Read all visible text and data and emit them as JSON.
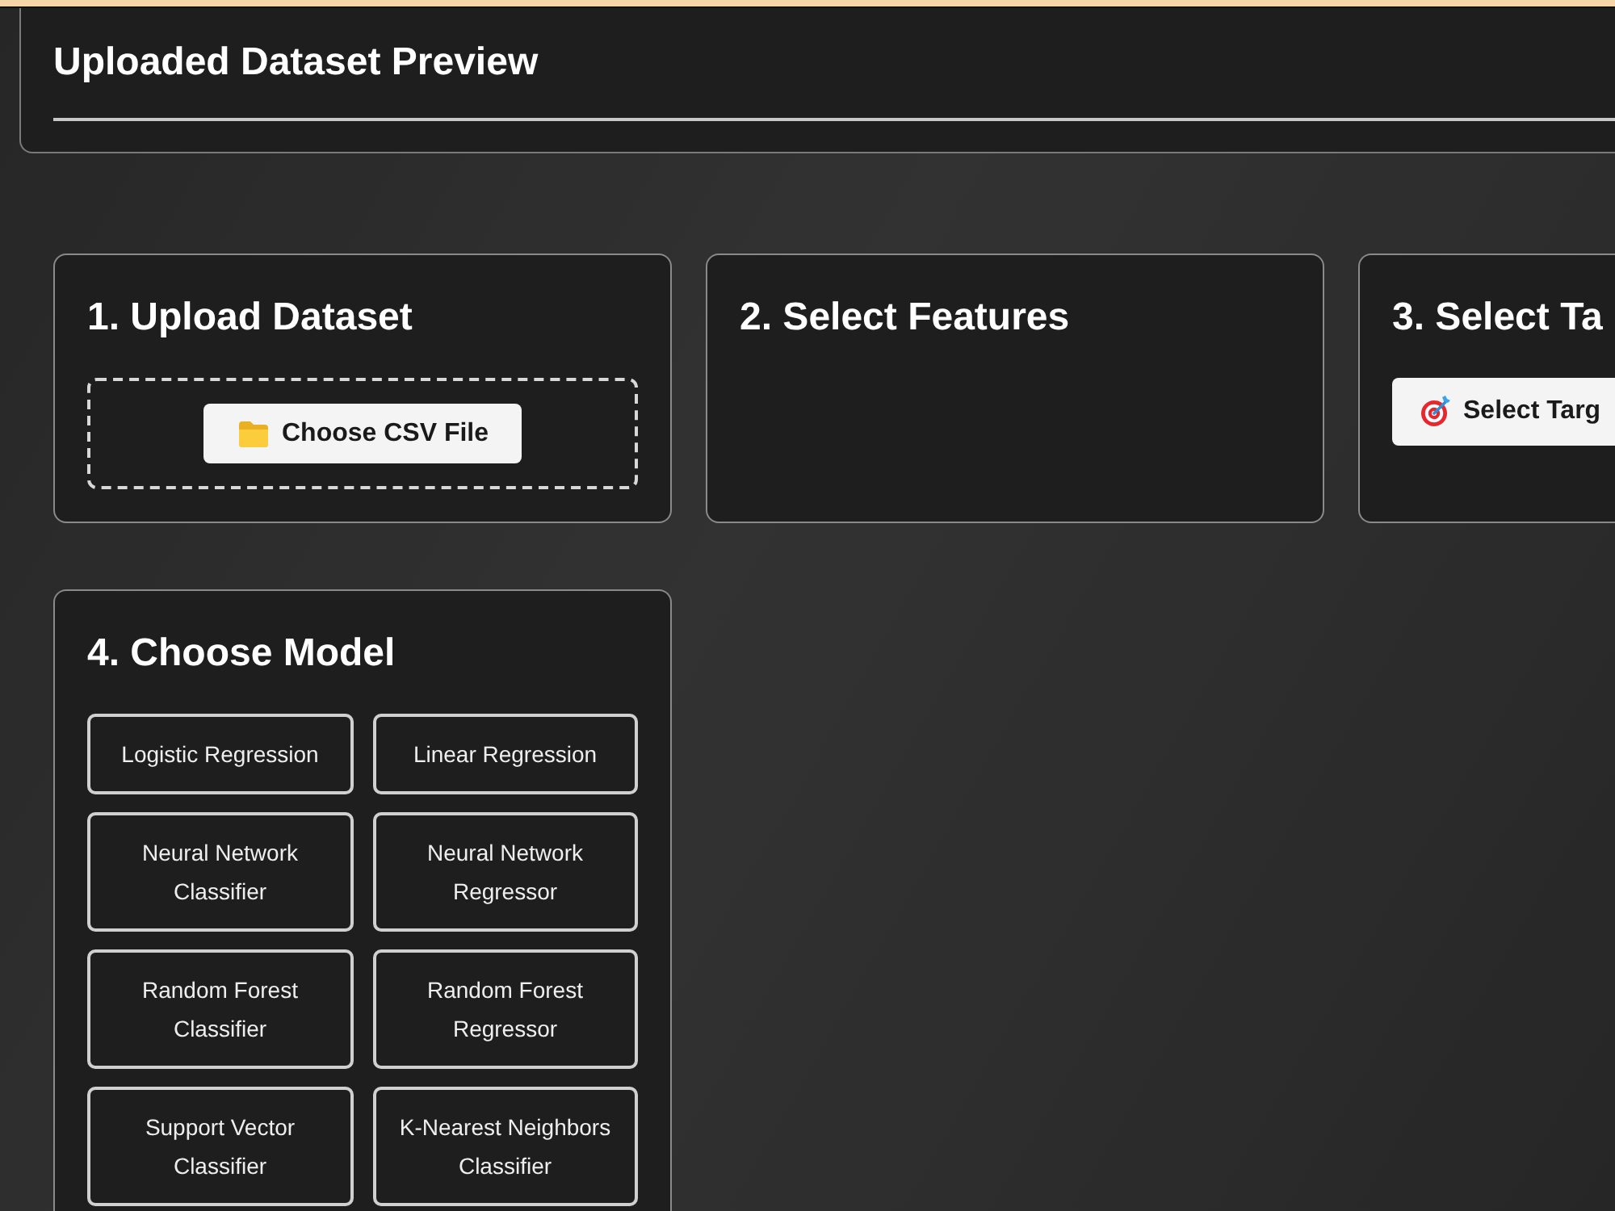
{
  "header": {
    "title": "Uploaded Dataset Preview"
  },
  "steps": [
    {
      "kind": "upload",
      "title": "1. Upload Dataset",
      "button": {
        "label": "Choose CSV File"
      }
    },
    {
      "kind": "features",
      "title": "2. Select Features"
    },
    {
      "kind": "target",
      "title": "3. Select Ta",
      "button": {
        "label": "Select Targ"
      }
    },
    {
      "kind": "model",
      "title": "4. Choose Model",
      "models": [
        "Logistic Regression",
        "Linear Regression",
        "Neural Network Classifier",
        "Neural Network Regressor",
        "Random Forest Classifier",
        "Random Forest Regressor",
        "Support Vector Classifier",
        "K-Nearest Neighbors Classifier"
      ]
    }
  ]
}
